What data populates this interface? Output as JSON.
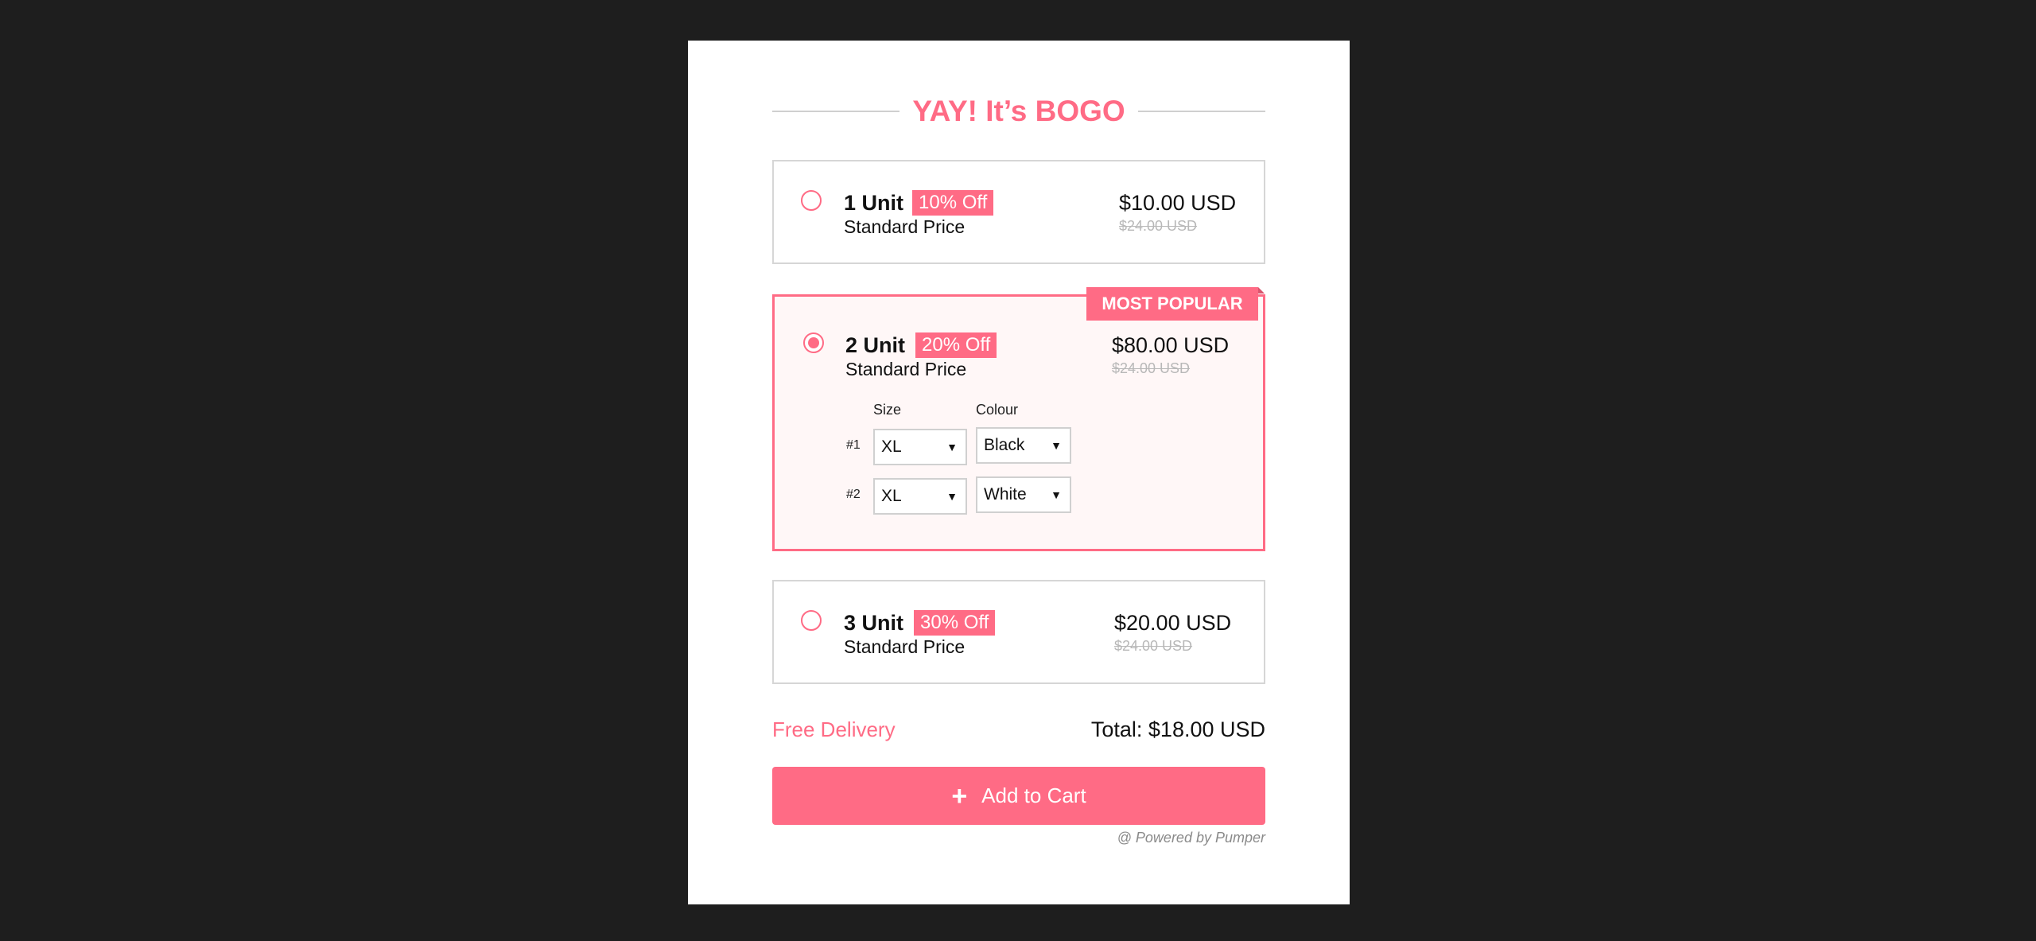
{
  "colors": {
    "background": "#1e1e1e",
    "accent": "#ff6b85",
    "selected_background": "#fff7f7"
  },
  "header": {
    "title": "YAY! It’s BOGO"
  },
  "options": [
    {
      "units": "1 Unit",
      "discount": "10% Off",
      "subtitle": "Standard Price",
      "price": "$10.00 USD",
      "compare_price": "$24.00 USD",
      "selected": false
    },
    {
      "units": "2 Unit",
      "discount": "20% Off",
      "subtitle": "Standard Price",
      "price": "$80.00 USD",
      "compare_price": "$24.00 USD",
      "selected": true,
      "badge": "MOST POPULAR",
      "size_label": "Size",
      "colour_label": "Colour",
      "variants": [
        {
          "label": "#1",
          "size": "XL",
          "colour": "Black"
        },
        {
          "label": "#2",
          "size": "XL",
          "colour": "White"
        }
      ]
    },
    {
      "units": "3 Unit",
      "discount": "30% Off",
      "subtitle": "Standard Price",
      "price": "$20.00 USD",
      "compare_price": "$24.00 USD",
      "selected": false
    }
  ],
  "footer": {
    "free_delivery": "Free Delivery",
    "total": "Total: $18.00 USD",
    "add_to_cart": "Add to Cart",
    "plus_icon": "+",
    "powered_by": "@ Powered by Pumper"
  }
}
